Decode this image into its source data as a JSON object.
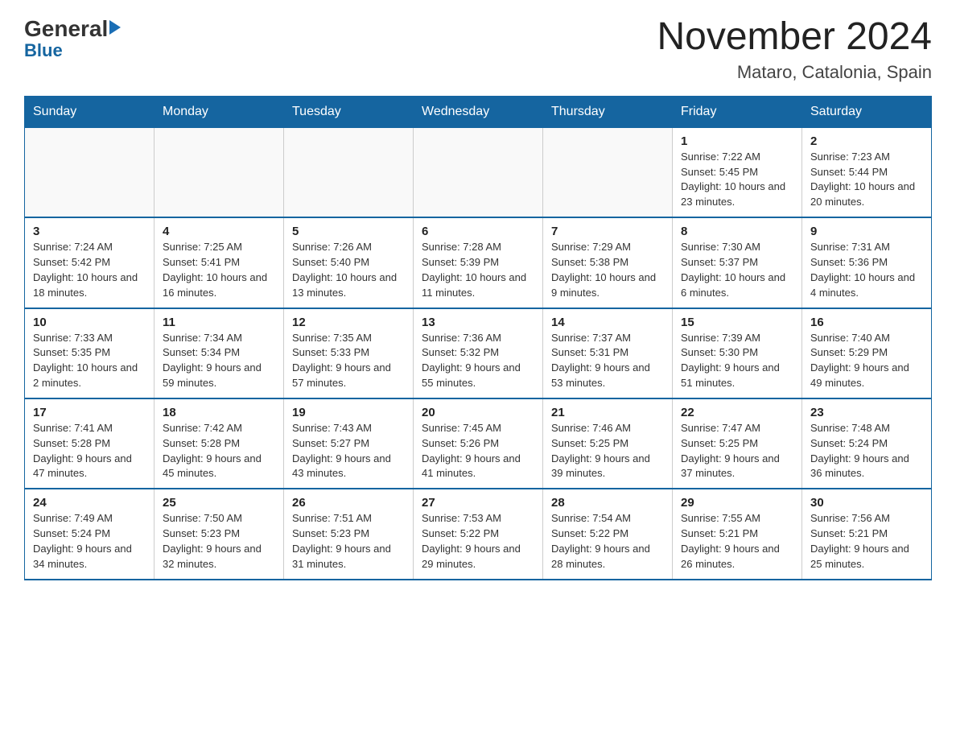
{
  "header": {
    "logo_general": "General",
    "logo_blue": "Blue",
    "title": "November 2024",
    "subtitle": "Mataro, Catalonia, Spain"
  },
  "weekdays": [
    "Sunday",
    "Monday",
    "Tuesday",
    "Wednesday",
    "Thursday",
    "Friday",
    "Saturday"
  ],
  "weeks": [
    [
      {
        "day": "",
        "sunrise": "",
        "sunset": "",
        "daylight": ""
      },
      {
        "day": "",
        "sunrise": "",
        "sunset": "",
        "daylight": ""
      },
      {
        "day": "",
        "sunrise": "",
        "sunset": "",
        "daylight": ""
      },
      {
        "day": "",
        "sunrise": "",
        "sunset": "",
        "daylight": ""
      },
      {
        "day": "",
        "sunrise": "",
        "sunset": "",
        "daylight": ""
      },
      {
        "day": "1",
        "sunrise": "Sunrise: 7:22 AM",
        "sunset": "Sunset: 5:45 PM",
        "daylight": "Daylight: 10 hours and 23 minutes."
      },
      {
        "day": "2",
        "sunrise": "Sunrise: 7:23 AM",
        "sunset": "Sunset: 5:44 PM",
        "daylight": "Daylight: 10 hours and 20 minutes."
      }
    ],
    [
      {
        "day": "3",
        "sunrise": "Sunrise: 7:24 AM",
        "sunset": "Sunset: 5:42 PM",
        "daylight": "Daylight: 10 hours and 18 minutes."
      },
      {
        "day": "4",
        "sunrise": "Sunrise: 7:25 AM",
        "sunset": "Sunset: 5:41 PM",
        "daylight": "Daylight: 10 hours and 16 minutes."
      },
      {
        "day": "5",
        "sunrise": "Sunrise: 7:26 AM",
        "sunset": "Sunset: 5:40 PM",
        "daylight": "Daylight: 10 hours and 13 minutes."
      },
      {
        "day": "6",
        "sunrise": "Sunrise: 7:28 AM",
        "sunset": "Sunset: 5:39 PM",
        "daylight": "Daylight: 10 hours and 11 minutes."
      },
      {
        "day": "7",
        "sunrise": "Sunrise: 7:29 AM",
        "sunset": "Sunset: 5:38 PM",
        "daylight": "Daylight: 10 hours and 9 minutes."
      },
      {
        "day": "8",
        "sunrise": "Sunrise: 7:30 AM",
        "sunset": "Sunset: 5:37 PM",
        "daylight": "Daylight: 10 hours and 6 minutes."
      },
      {
        "day": "9",
        "sunrise": "Sunrise: 7:31 AM",
        "sunset": "Sunset: 5:36 PM",
        "daylight": "Daylight: 10 hours and 4 minutes."
      }
    ],
    [
      {
        "day": "10",
        "sunrise": "Sunrise: 7:33 AM",
        "sunset": "Sunset: 5:35 PM",
        "daylight": "Daylight: 10 hours and 2 minutes."
      },
      {
        "day": "11",
        "sunrise": "Sunrise: 7:34 AM",
        "sunset": "Sunset: 5:34 PM",
        "daylight": "Daylight: 9 hours and 59 minutes."
      },
      {
        "day": "12",
        "sunrise": "Sunrise: 7:35 AM",
        "sunset": "Sunset: 5:33 PM",
        "daylight": "Daylight: 9 hours and 57 minutes."
      },
      {
        "day": "13",
        "sunrise": "Sunrise: 7:36 AM",
        "sunset": "Sunset: 5:32 PM",
        "daylight": "Daylight: 9 hours and 55 minutes."
      },
      {
        "day": "14",
        "sunrise": "Sunrise: 7:37 AM",
        "sunset": "Sunset: 5:31 PM",
        "daylight": "Daylight: 9 hours and 53 minutes."
      },
      {
        "day": "15",
        "sunrise": "Sunrise: 7:39 AM",
        "sunset": "Sunset: 5:30 PM",
        "daylight": "Daylight: 9 hours and 51 minutes."
      },
      {
        "day": "16",
        "sunrise": "Sunrise: 7:40 AM",
        "sunset": "Sunset: 5:29 PM",
        "daylight": "Daylight: 9 hours and 49 minutes."
      }
    ],
    [
      {
        "day": "17",
        "sunrise": "Sunrise: 7:41 AM",
        "sunset": "Sunset: 5:28 PM",
        "daylight": "Daylight: 9 hours and 47 minutes."
      },
      {
        "day": "18",
        "sunrise": "Sunrise: 7:42 AM",
        "sunset": "Sunset: 5:28 PM",
        "daylight": "Daylight: 9 hours and 45 minutes."
      },
      {
        "day": "19",
        "sunrise": "Sunrise: 7:43 AM",
        "sunset": "Sunset: 5:27 PM",
        "daylight": "Daylight: 9 hours and 43 minutes."
      },
      {
        "day": "20",
        "sunrise": "Sunrise: 7:45 AM",
        "sunset": "Sunset: 5:26 PM",
        "daylight": "Daylight: 9 hours and 41 minutes."
      },
      {
        "day": "21",
        "sunrise": "Sunrise: 7:46 AM",
        "sunset": "Sunset: 5:25 PM",
        "daylight": "Daylight: 9 hours and 39 minutes."
      },
      {
        "day": "22",
        "sunrise": "Sunrise: 7:47 AM",
        "sunset": "Sunset: 5:25 PM",
        "daylight": "Daylight: 9 hours and 37 minutes."
      },
      {
        "day": "23",
        "sunrise": "Sunrise: 7:48 AM",
        "sunset": "Sunset: 5:24 PM",
        "daylight": "Daylight: 9 hours and 36 minutes."
      }
    ],
    [
      {
        "day": "24",
        "sunrise": "Sunrise: 7:49 AM",
        "sunset": "Sunset: 5:24 PM",
        "daylight": "Daylight: 9 hours and 34 minutes."
      },
      {
        "day": "25",
        "sunrise": "Sunrise: 7:50 AM",
        "sunset": "Sunset: 5:23 PM",
        "daylight": "Daylight: 9 hours and 32 minutes."
      },
      {
        "day": "26",
        "sunrise": "Sunrise: 7:51 AM",
        "sunset": "Sunset: 5:23 PM",
        "daylight": "Daylight: 9 hours and 31 minutes."
      },
      {
        "day": "27",
        "sunrise": "Sunrise: 7:53 AM",
        "sunset": "Sunset: 5:22 PM",
        "daylight": "Daylight: 9 hours and 29 minutes."
      },
      {
        "day": "28",
        "sunrise": "Sunrise: 7:54 AM",
        "sunset": "Sunset: 5:22 PM",
        "daylight": "Daylight: 9 hours and 28 minutes."
      },
      {
        "day": "29",
        "sunrise": "Sunrise: 7:55 AM",
        "sunset": "Sunset: 5:21 PM",
        "daylight": "Daylight: 9 hours and 26 minutes."
      },
      {
        "day": "30",
        "sunrise": "Sunrise: 7:56 AM",
        "sunset": "Sunset: 5:21 PM",
        "daylight": "Daylight: 9 hours and 25 minutes."
      }
    ]
  ]
}
